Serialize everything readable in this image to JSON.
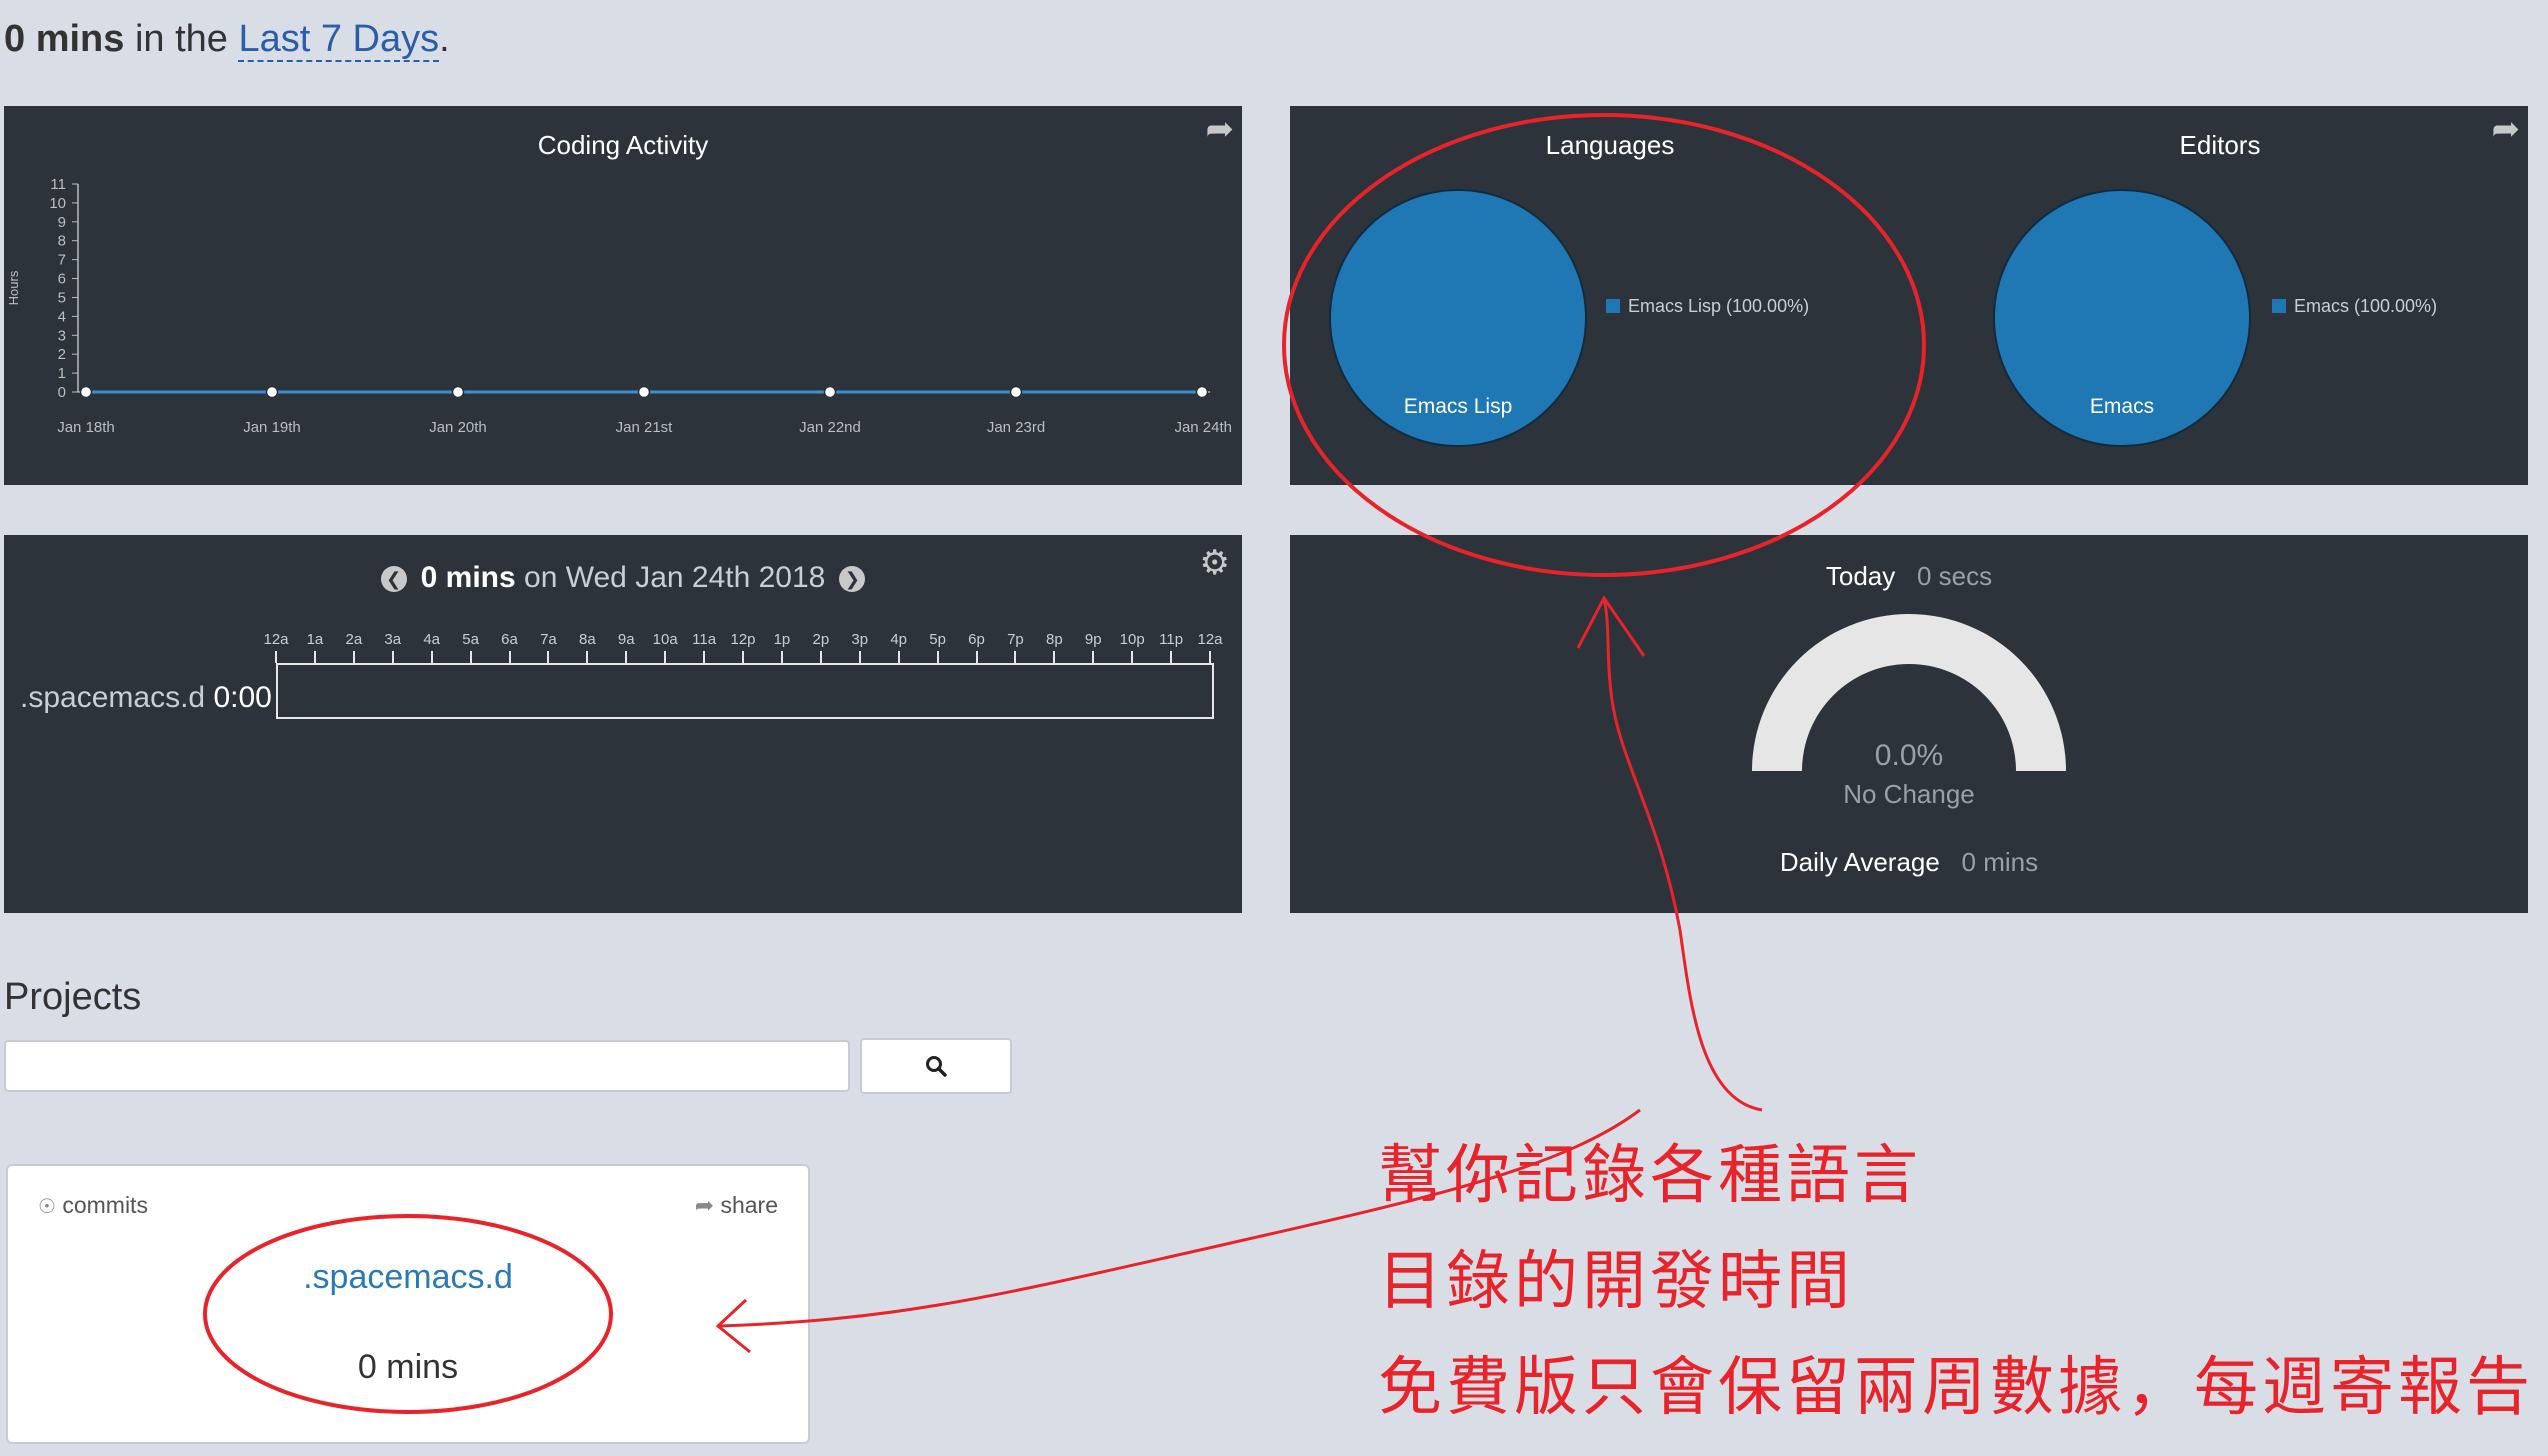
{
  "header": {
    "total": "0 mins",
    "middle": " in the ",
    "range_link": "Last 7 Days",
    "period": "."
  },
  "coding_activity": {
    "title": "Coding Activity",
    "y_axis_label": "Hours",
    "chart_data": {
      "type": "line",
      "title": "Coding Activity",
      "ylabel": "Hours",
      "x": [
        "Jan 18th",
        "Jan 19th",
        "Jan 20th",
        "Jan 21st",
        "Jan 22nd",
        "Jan 23rd",
        "Jan 24th"
      ],
      "series": [
        {
          "values": [
            0,
            0,
            0,
            0,
            0,
            0,
            0
          ]
        }
      ],
      "yticks": [
        "0",
        "1",
        "2",
        "3",
        "4",
        "5",
        "6",
        "7",
        "8",
        "9",
        "10",
        "11"
      ],
      "ylim": [
        0,
        11
      ]
    }
  },
  "languages": {
    "title": "Languages",
    "slice_label": "Emacs Lisp",
    "legend": "Emacs Lisp (100.00%)",
    "color": "#1f77b4"
  },
  "editors": {
    "title": "Editors",
    "slice_label": "Emacs",
    "legend": "Emacs (100.00%)",
    "color": "#1f77b4"
  },
  "day_view": {
    "total": "0 mins",
    "on": " on ",
    "date": "Wed Jan 24th 2018",
    "project": ".spacemacs.d",
    "project_time": "0:00",
    "hours": [
      "12a",
      "1a",
      "2a",
      "3a",
      "4a",
      "5a",
      "6a",
      "7a",
      "8a",
      "9a",
      "10a",
      "11a",
      "12p",
      "1p",
      "2p",
      "3p",
      "4p",
      "5p",
      "6p",
      "7p",
      "8p",
      "9p",
      "10p",
      "11p",
      "12a"
    ]
  },
  "today": {
    "label": "Today",
    "value": "0 secs",
    "gauge_percent": "0.0%",
    "change": "No Change",
    "daily_avg_label": "Daily Average",
    "daily_avg_value": "0 mins"
  },
  "projects": {
    "title": "Projects",
    "search_placeholder": "",
    "card": {
      "commits": "commits",
      "share": "share",
      "name": ".spacemacs.d",
      "time": "0 mins"
    }
  },
  "annotation": {
    "line1": "幫你記錄各種語言",
    "line2": "目錄的開發時間",
    "line3": "免費版只會保留兩周數據，每週寄報告"
  },
  "colors": {
    "panel": "#2d333b",
    "accent": "#1f77b4",
    "link": "#2a5ea8",
    "annotation": "#e8232a"
  }
}
